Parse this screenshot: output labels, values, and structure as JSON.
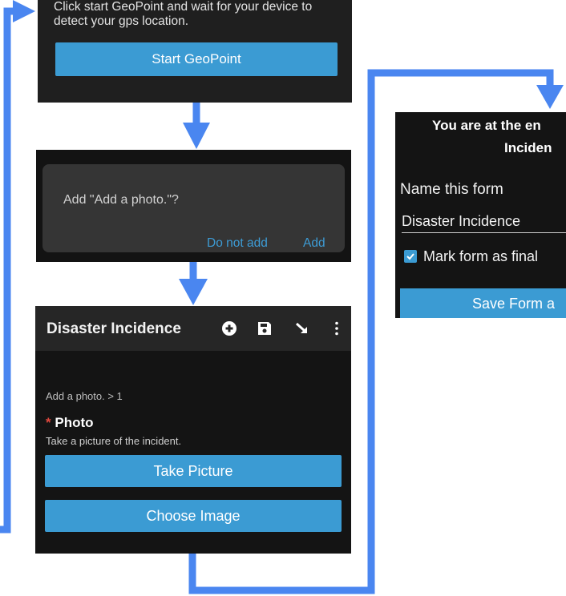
{
  "geopoint": {
    "instruction": "Click start GeoPoint and wait for your device to detect your gps location.",
    "button_label": "Start GeoPoint"
  },
  "dialog": {
    "message": "Add \"Add a photo.\"?",
    "do_not_add_label": "Do not add",
    "add_label": "Add"
  },
  "form": {
    "title": "Disaster Incidence",
    "toolbar_icons": [
      "add-circle-icon",
      "save-icon",
      "jump-icon",
      "more-vert-icon"
    ],
    "breadcrumb": "Add a photo. > 1",
    "required_marker": "*",
    "question_label": "Photo",
    "question_hint": "Take a picture of the incident.",
    "take_picture_label": "Take Picture",
    "choose_image_label": "Choose Image"
  },
  "save": {
    "end_line1": "You are at the en",
    "end_line2": "Inciden",
    "name_label": "Name this form",
    "name_value": "Disaster Incidence",
    "finalize_label": "Mark form as final",
    "finalize_checked": true,
    "save_button_label": "Save Form a"
  },
  "colors": {
    "arrow": "#4a86f0",
    "accent": "#3b9bd3",
    "required": "#e0483e"
  }
}
